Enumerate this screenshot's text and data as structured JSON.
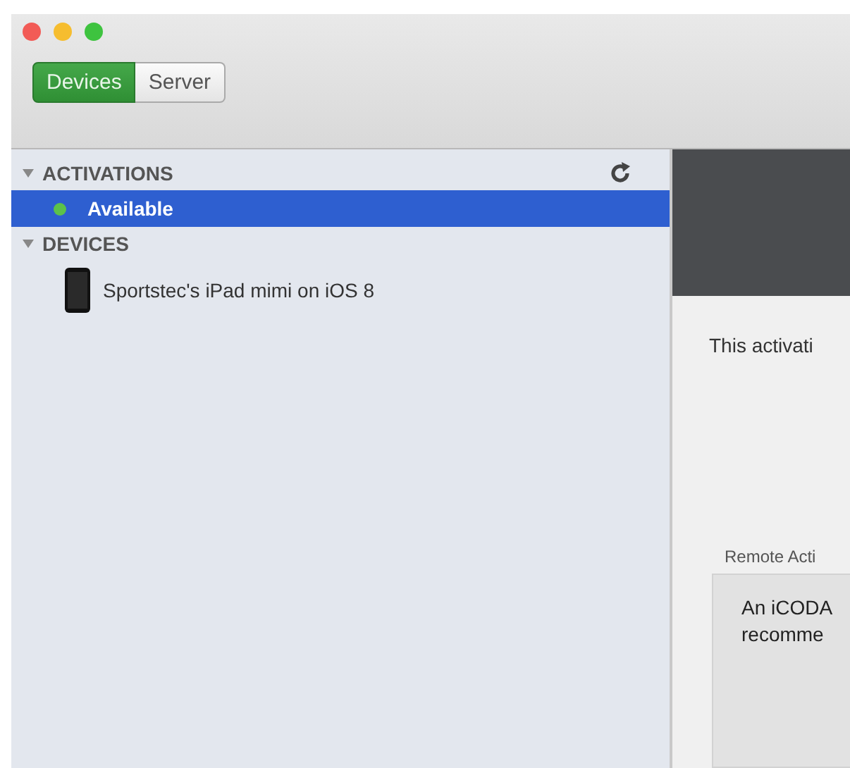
{
  "window": {
    "traffic_lights": [
      {
        "color": "#f25b56"
      },
      {
        "color": "#f6bd2f"
      },
      {
        "color": "#3ec33f"
      }
    ]
  },
  "tabs": [
    {
      "label": "Devices",
      "selected": true
    },
    {
      "label": "Server",
      "selected": false
    }
  ],
  "sidebar": {
    "sections": [
      {
        "title": "ACTIVATIONS",
        "expanded": true,
        "refresh": true,
        "items": [
          {
            "kind": "status",
            "label": "Available",
            "selected": true,
            "color": "#5cc24a"
          }
        ]
      },
      {
        "title": "DEVICES",
        "expanded": true,
        "refresh": false,
        "items": [
          {
            "kind": "device",
            "label": "Sportstec's iPad mimi on iOS 8",
            "selected": false
          }
        ]
      }
    ]
  },
  "detail": {
    "message": "This activati",
    "group_label": "Remote Acti",
    "group_lines": [
      "An iCODA",
      "recomme"
    ]
  }
}
